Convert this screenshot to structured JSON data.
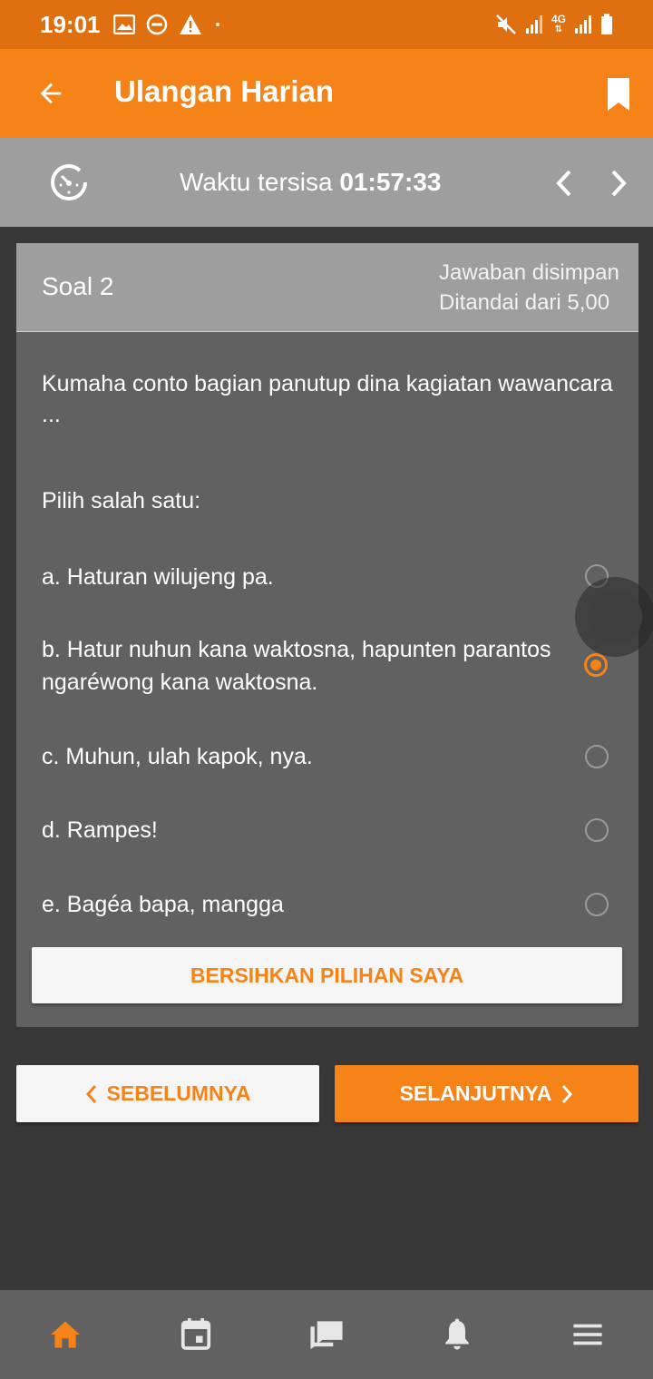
{
  "status_bar": {
    "time": "19:01",
    "left_icons": [
      "image-icon",
      "do-not-disturb-icon",
      "warning-icon"
    ],
    "right_icons": [
      "mute-icon",
      "signal-icon",
      "4g-icon",
      "signal-icon",
      "battery-icon"
    ],
    "network_label": "4G"
  },
  "app_bar": {
    "title": "Ulangan Harian",
    "back_icon": "arrow-back-icon",
    "bookmark_icon": "bookmark-icon"
  },
  "timer": {
    "label": "Waktu tersisa",
    "value": "01:57:33"
  },
  "question": {
    "number_label": "Soal 2",
    "status_line1": "Jawaban disimpan",
    "status_line2": "Ditandai dari 5,00",
    "text": "Kumaha conto bagian panutup dina kagiatan wawancara ...",
    "instruction": "Pilih salah satu:",
    "options": [
      {
        "label": "a. Haturan wilujeng pa.",
        "selected": false
      },
      {
        "label": "b. Hatur nuhun kana waktosna, hapunten parantos ngaréwong kana waktosna.",
        "selected": true
      },
      {
        "label": "c. Muhun, ulah kapok, nya.",
        "selected": false
      },
      {
        "label": "d. Rampes!",
        "selected": false
      },
      {
        "label": "e. Bagéa bapa, mangga",
        "selected": false
      }
    ],
    "clear_label": "BERSIHKAN PILIHAN SAYA"
  },
  "navigation": {
    "prev_label": "SEBELUMNYA",
    "next_label": "SELANJUTNYA"
  },
  "bottom_nav": {
    "items": [
      "home-icon",
      "calendar-icon",
      "messages-icon",
      "notifications-icon",
      "menu-icon"
    ],
    "active": "home-icon"
  },
  "colors": {
    "accent": "#f58317",
    "status_bar": "#e0700f",
    "timer_bar": "#9e9e9e",
    "card": "#616161",
    "background": "#383838"
  }
}
